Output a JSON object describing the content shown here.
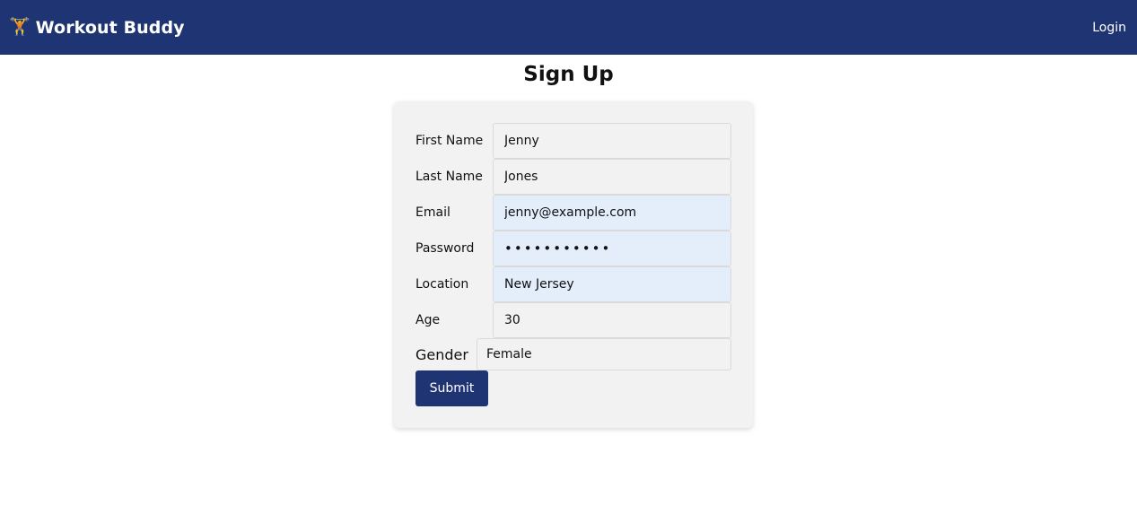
{
  "navbar": {
    "brand_icon": "🏋️",
    "brand_title": "Workout Buddy",
    "login_label": "Login",
    "background_color": "#1f3573"
  },
  "page": {
    "title": "Sign Up"
  },
  "form": {
    "first_name": {
      "label": "First Name",
      "value": "Jenny"
    },
    "last_name": {
      "label": "Last Name",
      "value": "Jones"
    },
    "email": {
      "label": "Email",
      "value": "jenny@example.com"
    },
    "password": {
      "label": "Password",
      "value": "•••••••••••"
    },
    "location": {
      "label": "Location",
      "value": "New Jersey"
    },
    "age": {
      "label": "Age",
      "value": "30"
    },
    "gender": {
      "label": "Gender",
      "selected": "Female"
    },
    "submit_label": "Submit"
  }
}
